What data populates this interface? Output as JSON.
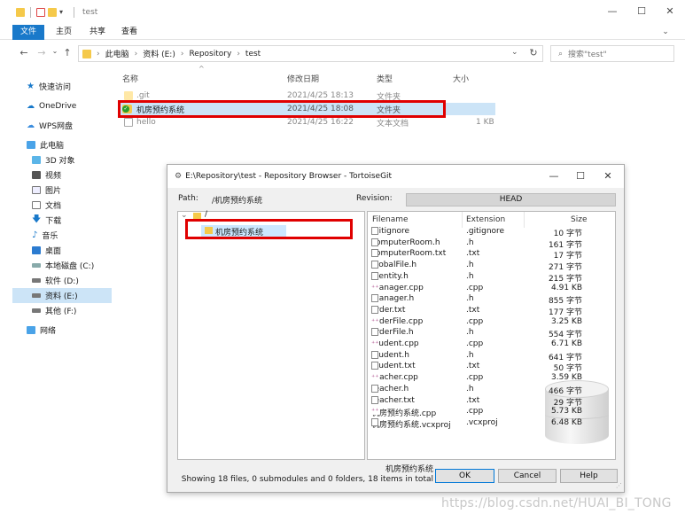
{
  "explorer": {
    "title": "test",
    "ribbon_tabs": [
      "文件",
      "主页",
      "共享",
      "查看"
    ],
    "breadcrumb": [
      "此电脑",
      "资料 (E:)",
      "Repository",
      "test"
    ],
    "search_placeholder": "搜索\"test\"",
    "window_controls": {
      "minimize": "—",
      "maximize": "☐",
      "close": "✕",
      "expand": "⌄"
    },
    "nav_items": [
      {
        "label": "快速访问",
        "icon": "star-icon"
      },
      {
        "label": "OneDrive",
        "icon": "cloud-icon"
      },
      {
        "label": "WPS网盘",
        "icon": "cloud-icon"
      },
      {
        "label": "此电脑",
        "icon": "computer-icon"
      },
      {
        "label": "3D 对象",
        "icon": "cube-icon"
      },
      {
        "label": "视频",
        "icon": "video-icon"
      },
      {
        "label": "图片",
        "icon": "picture-icon"
      },
      {
        "label": "文档",
        "icon": "document-icon"
      },
      {
        "label": "下载",
        "icon": "download-icon"
      },
      {
        "label": "音乐",
        "icon": "music-icon"
      },
      {
        "label": "桌面",
        "icon": "desktop-icon"
      },
      {
        "label": "本地磁盘 (C:)",
        "icon": "drive-icon"
      },
      {
        "label": "软件 (D:)",
        "icon": "drive-icon"
      },
      {
        "label": "资料 (E:)",
        "icon": "drive-icon",
        "selected": true
      },
      {
        "label": "其他 (F:)",
        "icon": "drive-icon"
      },
      {
        "label": "网络",
        "icon": "network-icon"
      }
    ],
    "columns": {
      "name": "名称",
      "date": "修改日期",
      "type": "类型",
      "size": "大小"
    },
    "files": [
      {
        "name": ".git",
        "date": "2021/4/25 18:13",
        "type": "文件夹",
        "size": ""
      },
      {
        "name": "机房预约系统",
        "date": "2021/4/25 18:08",
        "type": "文件夹",
        "size": ""
      },
      {
        "name": "hello",
        "date": "2021/4/25 16:22",
        "type": "文本文档",
        "size": "1 KB"
      }
    ]
  },
  "dialog": {
    "title": "E:\\Repository\\test - Repository Browser - TortoiseGit",
    "path_label": "Path:",
    "path_value": "/机房预约系统",
    "revision_label": "Revision:",
    "revision_value": "HEAD",
    "tree_root": "/",
    "tree_child": "机房预约系统",
    "list_headers": {
      "filename": "Filename",
      "extension": "Extension",
      "size": "Size"
    },
    "list_rows": [
      {
        "name": ".gitignore",
        "ext": ".gitignore",
        "size": "10 字节",
        "kind": "txt"
      },
      {
        "name": "computerRoom.h",
        "ext": ".h",
        "size": "161 字节",
        "kind": "h"
      },
      {
        "name": "computerRoom.txt",
        "ext": ".txt",
        "size": "17 字节",
        "kind": "txt"
      },
      {
        "name": "globalFile.h",
        "ext": ".h",
        "size": "271 字节",
        "kind": "h"
      },
      {
        "name": "Identity.h",
        "ext": ".h",
        "size": "215 字节",
        "kind": "h"
      },
      {
        "name": "manager.cpp",
        "ext": ".cpp",
        "size": "4.91 KB",
        "kind": "cpp"
      },
      {
        "name": "manager.h",
        "ext": ".h",
        "size": "855 字节",
        "kind": "h"
      },
      {
        "name": "order.txt",
        "ext": ".txt",
        "size": "177 字节",
        "kind": "txt"
      },
      {
        "name": "orderFile.cpp",
        "ext": ".cpp",
        "size": "3.25 KB",
        "kind": "cpp"
      },
      {
        "name": "orderFile.h",
        "ext": ".h",
        "size": "554 字节",
        "kind": "h"
      },
      {
        "name": "student.cpp",
        "ext": ".cpp",
        "size": "6.71 KB",
        "kind": "cpp"
      },
      {
        "name": "student.h",
        "ext": ".h",
        "size": "641 字节",
        "kind": "h"
      },
      {
        "name": "student.txt",
        "ext": ".txt",
        "size": "50 字节",
        "kind": "txt"
      },
      {
        "name": "teacher.cpp",
        "ext": ".cpp",
        "size": "3.59 KB",
        "kind": "cpp"
      },
      {
        "name": "teacher.h",
        "ext": ".h",
        "size": "466 字节",
        "kind": "h"
      },
      {
        "name": "teacher.txt",
        "ext": ".txt",
        "size": "29 字节",
        "kind": "txt"
      },
      {
        "name": "机房预约系统.cpp",
        "ext": ".cpp",
        "size": "5.73 KB",
        "kind": "cpp"
      },
      {
        "name": "机房预约系统.vcxproj",
        "ext": ".vcxproj",
        "size": "6.48 KB",
        "kind": "proj"
      }
    ],
    "status_line1": "机房预约系统",
    "status_line2": "Showing 18 files, 0 submodules and 0 folders, 18 items in total",
    "ok_label": "OK",
    "cancel_label": "Cancel",
    "help_label": "Help"
  },
  "watermark": "https://blog.csdn.net/HUAI_BI_TONG",
  "colors": {
    "accent": "#1979ca",
    "highlight": "#e00000",
    "selection": "#cce4f7",
    "folder": "#ffd867"
  }
}
